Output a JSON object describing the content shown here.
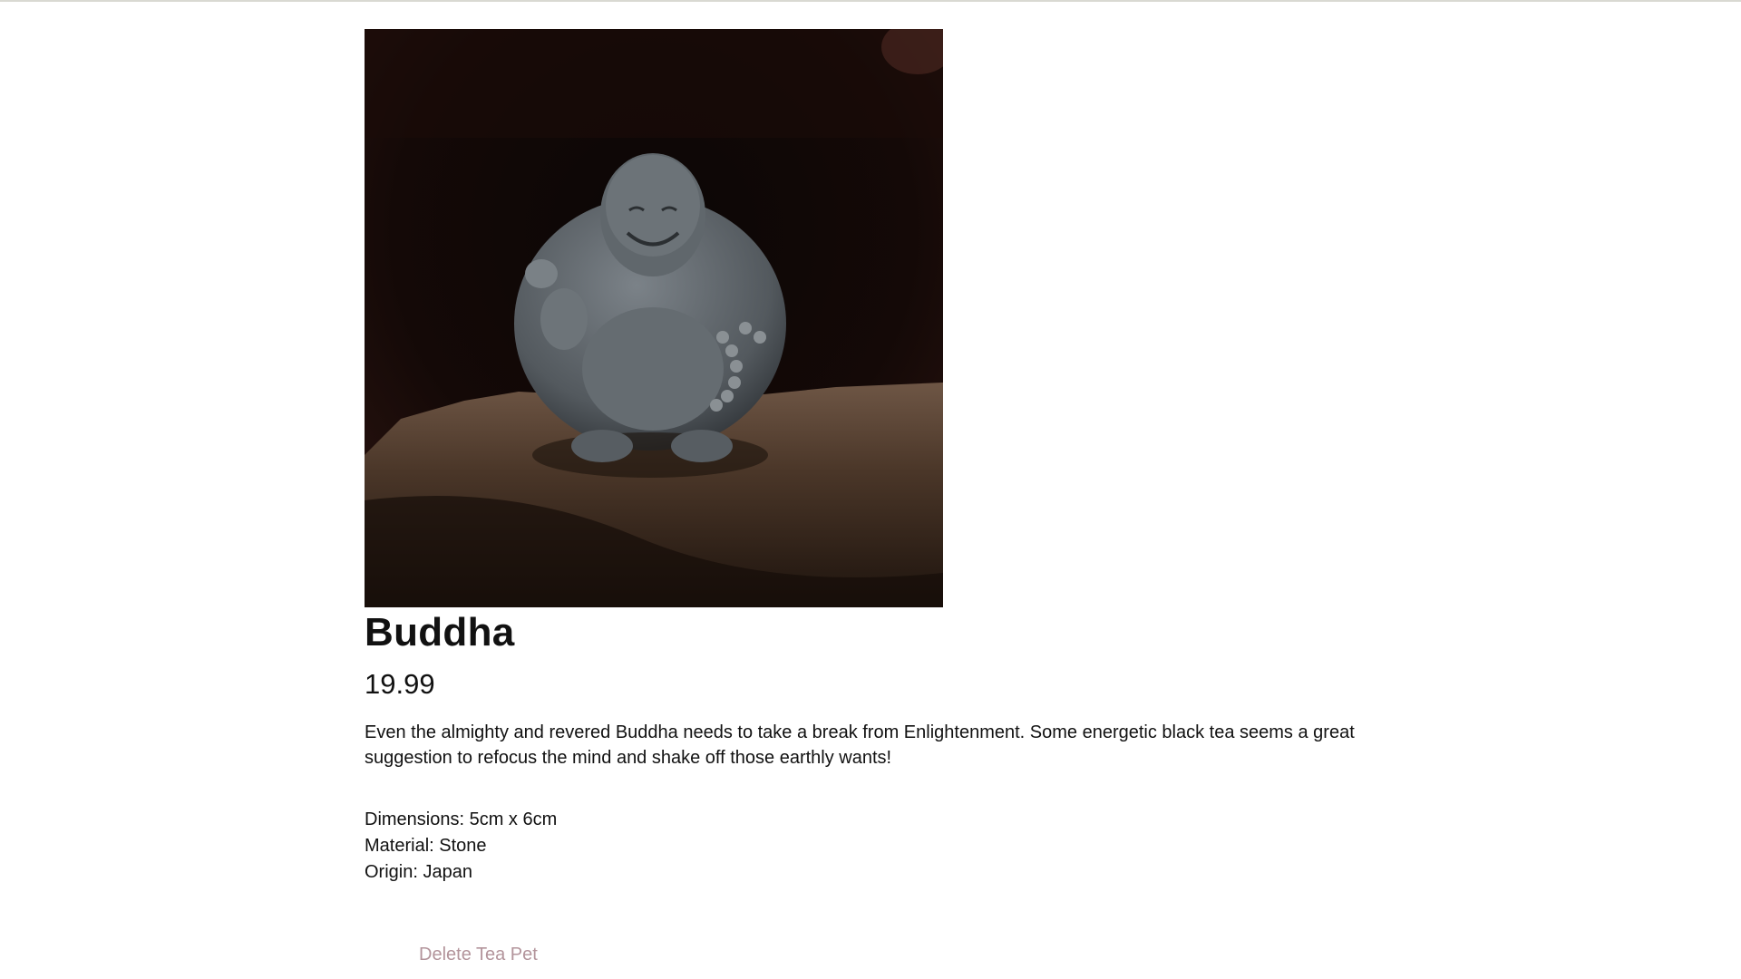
{
  "product": {
    "image_alt": "Stone Buddha tea pet sitting on a rock",
    "name": "Buddha",
    "price": "19.99",
    "description": "Even the almighty and revered Buddha needs to take a break from Enlightenment. Some energetic black tea seems a great suggestion to refocus the mind and shake off those earthly wants!",
    "details": {
      "dimensions": "Dimensions: 5cm x 6cm",
      "material": "Material: Stone",
      "origin": "Origin: Japan"
    }
  },
  "actions": {
    "delete_label": "Delete Tea Pet"
  },
  "colors": {
    "delete_text": "#b3949b",
    "top_rule": "#d9d9d2"
  }
}
